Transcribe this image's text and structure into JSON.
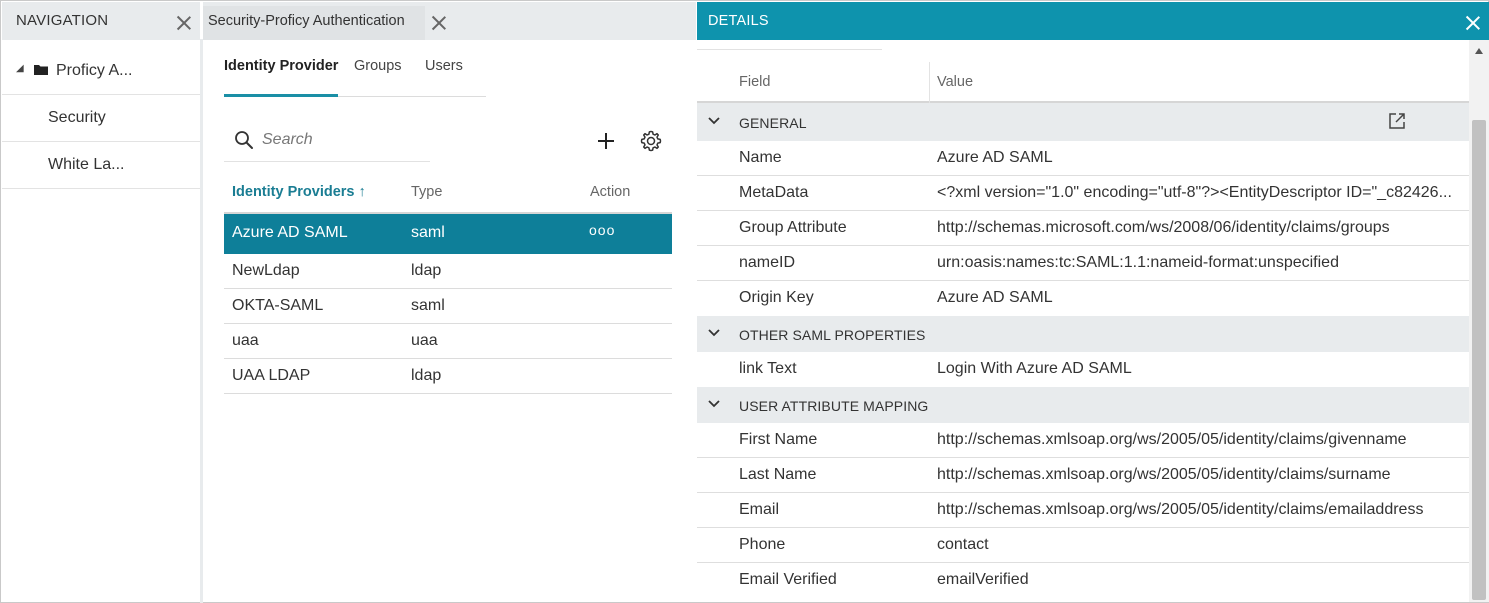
{
  "navigation": {
    "title": "NAVIGATION",
    "tree": [
      {
        "label": "Proficy A...",
        "expanded": true,
        "icon": "folder-icon"
      },
      {
        "label": "Security"
      },
      {
        "label": "White La..."
      }
    ]
  },
  "security_panel": {
    "tab_title": "Security-Proficy Authentication",
    "subtabs": [
      "Identity Provider",
      "Groups",
      "Users"
    ],
    "active_subtab": "Identity Provider",
    "search": {
      "placeholder": "Search",
      "value": ""
    },
    "table": {
      "headers": {
        "name": "Identity Providers",
        "sort_indicator": "↑",
        "type": "Type",
        "action": "Action"
      },
      "rows": [
        {
          "name": "Azure AD SAML",
          "type": "saml",
          "action": "ooo",
          "selected": true
        },
        {
          "name": "NewLdap",
          "type": "ldap",
          "action": ""
        },
        {
          "name": "OKTA-SAML",
          "type": "saml",
          "action": ""
        },
        {
          "name": "uaa",
          "type": "uaa",
          "action": ""
        },
        {
          "name": "UAA LDAP",
          "type": "ldap",
          "action": ""
        }
      ]
    }
  },
  "details": {
    "title": "DETAILS",
    "columns": {
      "field": "Field",
      "value": "Value"
    },
    "groups": [
      {
        "label": "GENERAL",
        "rows": [
          {
            "field": "Name",
            "value": "Azure AD SAML"
          },
          {
            "field": "MetaData",
            "value": "<?xml version=\"1.0\" encoding=\"utf-8\"?><EntityDescriptor ID=\"_c82426..."
          },
          {
            "field": "Group Attribute",
            "value": "http://schemas.microsoft.com/ws/2008/06/identity/claims/groups"
          },
          {
            "field": "nameID",
            "value": "urn:oasis:names:tc:SAML:1.1:nameid-format:unspecified"
          },
          {
            "field": "Origin Key",
            "value": "Azure AD SAML"
          }
        ]
      },
      {
        "label": "OTHER SAML PROPERTIES",
        "rows": [
          {
            "field": "link Text",
            "value": "Login With Azure AD SAML"
          }
        ]
      },
      {
        "label": "USER ATTRIBUTE MAPPING",
        "rows": [
          {
            "field": "First Name",
            "value": "http://schemas.xmlsoap.org/ws/2005/05/identity/claims/givenname"
          },
          {
            "field": "Last Name",
            "value": "http://schemas.xmlsoap.org/ws/2005/05/identity/claims/surname"
          },
          {
            "field": "Email",
            "value": "http://schemas.xmlsoap.org/ws/2005/05/identity/claims/emailaddress"
          },
          {
            "field": "Phone",
            "value": "contact"
          },
          {
            "field": "Email Verified",
            "value": "emailVerified"
          }
        ]
      }
    ]
  },
  "colors": {
    "accent": "#0e93ad",
    "selected_row": "#0e7f99",
    "header_gray": "#e8ebed",
    "link_teal": "#1a7d93"
  }
}
